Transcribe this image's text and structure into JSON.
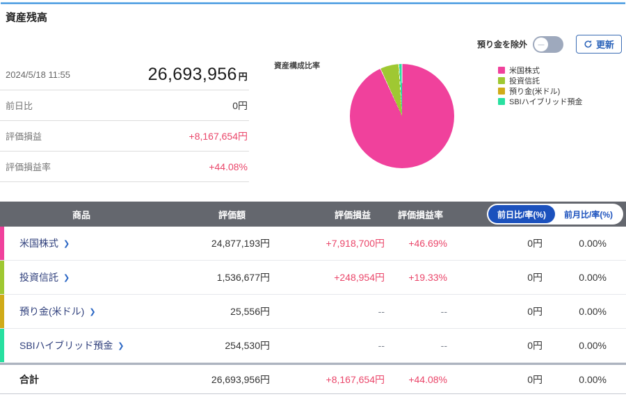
{
  "header": {
    "title": "資産残高"
  },
  "controls": {
    "toggle_label": "預り金を除外",
    "toggle_state": "off",
    "refresh_label": "更新"
  },
  "summary": {
    "timestamp": "2024/5/18 11:55",
    "total_value": "26,693,956",
    "currency": "円",
    "rows": [
      {
        "label": "前日比",
        "value": "0円",
        "tone": "normal"
      },
      {
        "label": "評価損益",
        "value": "+8,167,654円",
        "tone": "pink"
      },
      {
        "label": "評価損益率",
        "value": "+44.08%",
        "tone": "pink"
      }
    ]
  },
  "pie_section": {
    "title": "資産構成比率"
  },
  "chart_data": {
    "type": "pie",
    "title": "資産構成比率",
    "labels": [
      "米国株式",
      "投資信託",
      "預り金(米ドル)",
      "SBIハイブリッド預金"
    ],
    "values": [
      24877193,
      1536677,
      25556,
      254530
    ],
    "percentages": [
      93.19,
      5.76,
      0.1,
      0.95
    ],
    "unit": "円",
    "colors": [
      "#f0419c",
      "#9fc832",
      "#d0ab18",
      "#28e0a0"
    ],
    "legend_position": "right",
    "start_angle_deg": 0,
    "direction": "clockwise"
  },
  "table": {
    "columns": [
      "商品",
      "評価額",
      "評価損益",
      "評価損益率"
    ],
    "period_toggle": {
      "selected": "前日比/率(%)",
      "unselected": "前月比/率(%)"
    },
    "rows": [
      {
        "name": "米国株式",
        "strip_color": "#f0419c",
        "value": "24,877,193円",
        "gain": "+7,918,700円",
        "gain_rate": "+46.69%",
        "day_change": "0円",
        "day_change_rate": "0.00%",
        "gain_tone": "pink"
      },
      {
        "name": "投資信託",
        "strip_color": "#9fc832",
        "value": "1,536,677円",
        "gain": "+248,954円",
        "gain_rate": "+19.33%",
        "day_change": "0円",
        "day_change_rate": "0.00%",
        "gain_tone": "pink"
      },
      {
        "name": "預り金(米ドル)",
        "strip_color": "#d0ab18",
        "value": "25,556円",
        "gain": "--",
        "gain_rate": "--",
        "day_change": "0円",
        "day_change_rate": "0.00%",
        "gain_tone": "muted"
      },
      {
        "name": "SBIハイブリッド預金",
        "strip_color": "#28e0a0",
        "value": "254,530円",
        "gain": "--",
        "gain_rate": "--",
        "day_change": "0円",
        "day_change_rate": "0.00%",
        "gain_tone": "muted"
      }
    ],
    "total_row": {
      "name": "合計",
      "value": "26,693,956円",
      "gain": "+8,167,654円",
      "gain_rate": "+44.08%",
      "day_change": "0円",
      "day_change_rate": "0.00%"
    }
  },
  "icons": {
    "chevron_right": "❯",
    "toggle_minus": "—",
    "refresh": "⟳"
  }
}
